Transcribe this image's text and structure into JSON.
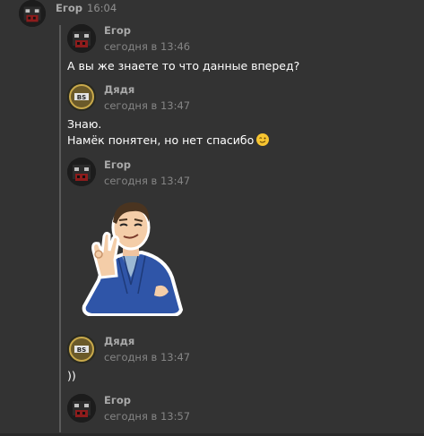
{
  "header": {
    "author": "Егор",
    "time": "16:04"
  },
  "messages": [
    {
      "author": "Егор",
      "time": "сегодня в 13:46",
      "text": "А вы же знаете то что данные вперед?"
    },
    {
      "author": "Дядя",
      "time": "сегодня в 13:47",
      "lines": [
        "Знаю.",
        "Намёк понятен, но нет спасибо"
      ],
      "emoji": "winking-face"
    },
    {
      "author": "Егор",
      "time": "сегодня в 13:47",
      "sticker": "businessman-ok-gesture-sticker"
    },
    {
      "author": "Дядя",
      "time": "сегодня в 13:47",
      "text": "))"
    },
    {
      "author": "Егор",
      "time": "сегодня в 13:57"
    }
  ],
  "colors": {
    "background": "#333333",
    "thread_line": "#5a5a5a",
    "text": "#ffffff",
    "meta": "#858585"
  }
}
